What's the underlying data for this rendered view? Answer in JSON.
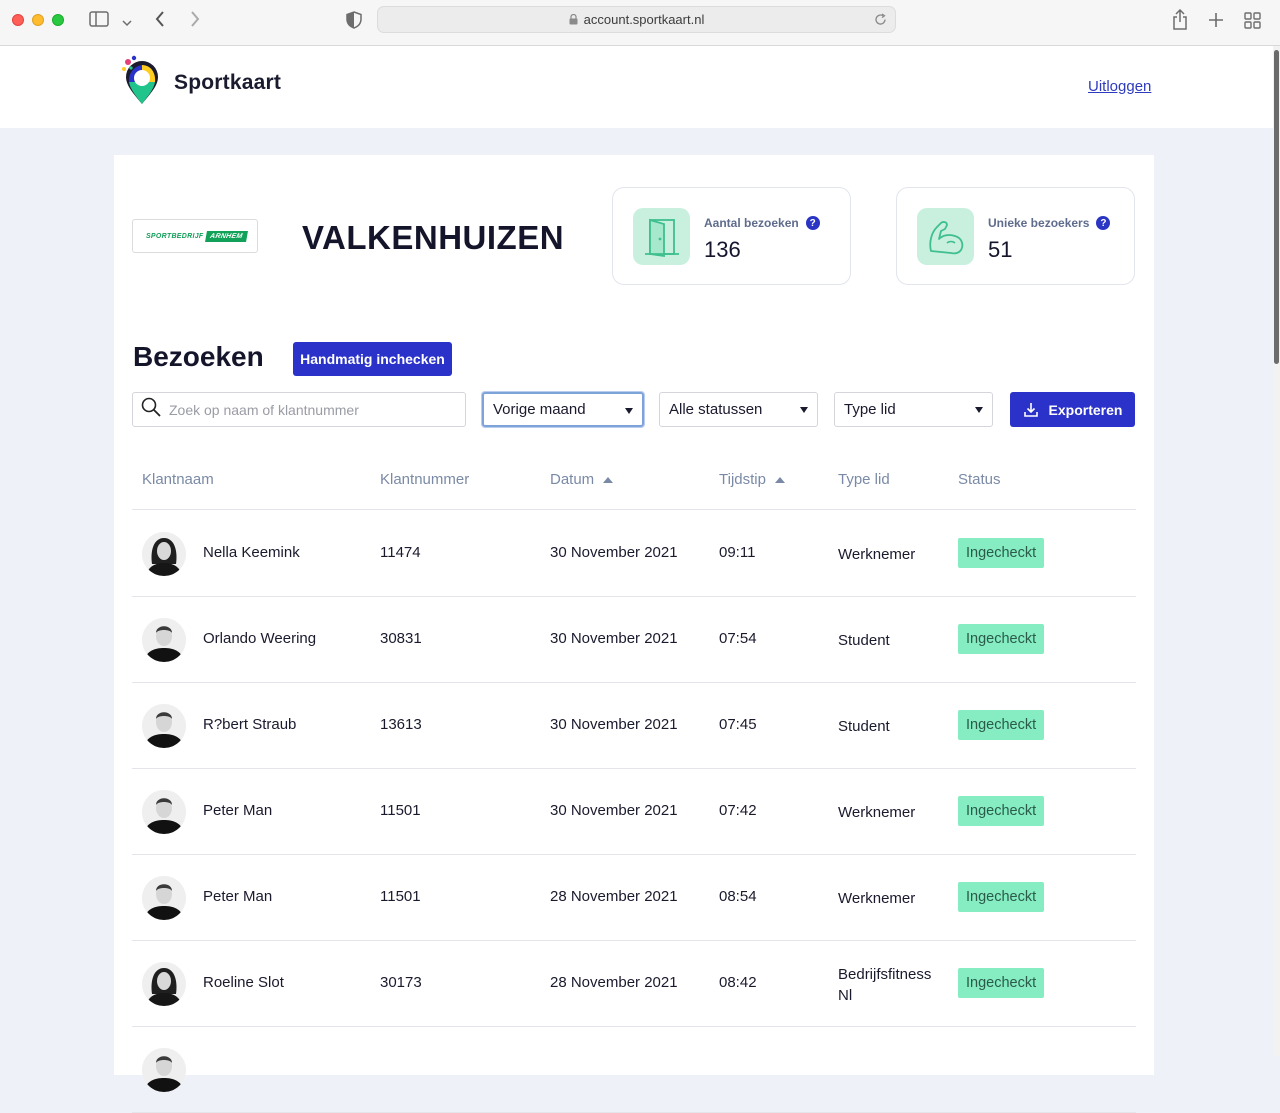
{
  "browser": {
    "url": "account.sportkaart.nl"
  },
  "header": {
    "logo_text": "Sportkaart",
    "logout": "Uitloggen"
  },
  "organization": {
    "badge_left": "SPORTBEDRIJF",
    "badge_right": "ARNHEM"
  },
  "location": {
    "title": "VALKENHUIZEN"
  },
  "stats": [
    {
      "label": "Aantal bezoeken",
      "value": "136",
      "icon": "door-icon"
    },
    {
      "label": "Unieke bezoekers",
      "value": "51",
      "icon": "muscle-arm-icon"
    }
  ],
  "visits": {
    "title": "Bezoeken",
    "checkin_button": "Handmatig inchecken",
    "search_placeholder": "Zoek op naam of klantnummer",
    "filters": {
      "period": "Vorige maand",
      "status": "Alle statussen",
      "member_type": "Type lid"
    },
    "export_button": "Exporteren",
    "columns": [
      "Klantnaam",
      "Klantnummer",
      "Datum",
      "Tijdstip",
      "Type lid",
      "Status"
    ],
    "rows": [
      {
        "name": "Nella Keemink",
        "number": "11474",
        "date": "30 November 2021",
        "time": "09:11",
        "type": "Werknemer",
        "status": "Ingecheckt"
      },
      {
        "name": "Orlando Weering",
        "number": "30831",
        "date": "30 November 2021",
        "time": "07:54",
        "type": "Student",
        "status": "Ingecheckt"
      },
      {
        "name": "R?bert Straub",
        "number": "13613",
        "date": "30 November 2021",
        "time": "07:45",
        "type": "Student",
        "status": "Ingecheckt"
      },
      {
        "name": "Peter Man",
        "number": "11501",
        "date": "30 November 2021",
        "time": "07:42",
        "type": "Werknemer",
        "status": "Ingecheckt"
      },
      {
        "name": "Peter Man",
        "number": "11501",
        "date": "28 November 2021",
        "time": "08:54",
        "type": "Werknemer",
        "status": "Ingecheckt"
      },
      {
        "name": "Roeline Slot",
        "number": "30173",
        "date": "28 November 2021",
        "time": "08:42",
        "type": "Bedrijfsfitness Nl",
        "status": "Ingecheckt"
      }
    ]
  },
  "colors": {
    "primary": "#2b32c9",
    "status_green": "#86ecc2",
    "icon_bg": "#c9f0df"
  }
}
